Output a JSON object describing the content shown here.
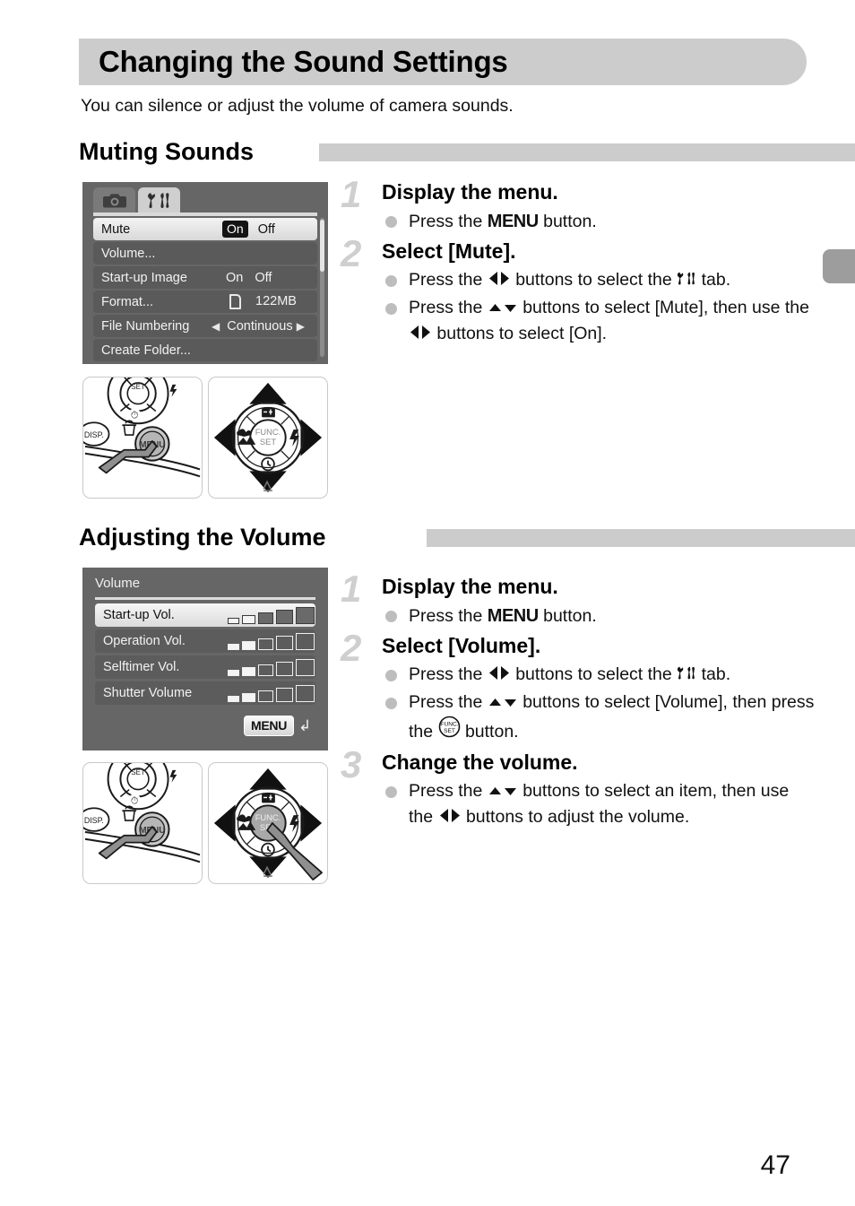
{
  "page": {
    "title": "Changing the Sound Settings",
    "intro": "You can silence or adjust the volume of camera sounds.",
    "page_number": "47"
  },
  "sections": [
    {
      "id": "muting",
      "heading": "Muting Sounds"
    },
    {
      "id": "volume",
      "heading": "Adjusting the Volume"
    }
  ],
  "menu_screen": {
    "tabs": [
      {
        "name": "camera-tab",
        "icon": "camera-icon",
        "active": false
      },
      {
        "name": "settings-tab",
        "icon": "wrench-tools-icon",
        "active": true
      }
    ],
    "rows": [
      {
        "label": "Mute",
        "selected": true,
        "value_on": "On",
        "value_off": "Off"
      },
      {
        "label": "Volume...",
        "selected": false,
        "value": ""
      },
      {
        "label": "Start-up Image",
        "selected": false,
        "value_on": "On",
        "value_off": "Off"
      },
      {
        "label": "Format...",
        "selected": false,
        "value": "122MB",
        "icon": "memory-card-icon"
      },
      {
        "label": "File Numbering",
        "selected": false,
        "value": "Continuous",
        "arrows": true
      },
      {
        "label": "Create Folder...",
        "selected": false,
        "value": ""
      }
    ]
  },
  "volume_screen": {
    "title": "Volume",
    "rows": [
      {
        "label": "Start-up Vol.",
        "selected": true,
        "level": 2,
        "max": 5
      },
      {
        "label": "Operation Vol.",
        "selected": false,
        "level": 2,
        "max": 5
      },
      {
        "label": "Selftimer Vol.",
        "selected": false,
        "level": 2,
        "max": 5
      },
      {
        "label": "Shutter Volume",
        "selected": false,
        "level": 2,
        "max": 5
      }
    ],
    "return_button": "MENU",
    "return_icon": "return-arrow-icon"
  },
  "photos": {
    "menu_button_photo": "camera-back-menu-button-photo",
    "dpad_photo": "camera-dpad-photo",
    "dpad_func_set_photo": "camera-dpad-func-set-photo",
    "labels": {
      "disp": "DISP.",
      "menu": "MENU",
      "set": "SET",
      "func_set_line1": "FUNC.",
      "func_set_line2": "SET"
    }
  },
  "steps_muting": [
    {
      "number": "1",
      "heading": "Display the menu.",
      "bullets": [
        {
          "parts": [
            {
              "t": "text",
              "v": "Press the "
            },
            {
              "t": "menu",
              "v": "MENU"
            },
            {
              "t": "text",
              "v": " button."
            }
          ]
        }
      ]
    },
    {
      "number": "2",
      "heading": "Select [Mute].",
      "bullets": [
        {
          "parts": [
            {
              "t": "text",
              "v": "Press the "
            },
            {
              "t": "icon",
              "v": "left-right-arrows-icon"
            },
            {
              "t": "text",
              "v": " buttons to select the "
            },
            {
              "t": "icon",
              "v": "wrench-tools-icon"
            },
            {
              "t": "text",
              "v": " tab."
            }
          ]
        },
        {
          "parts": [
            {
              "t": "text",
              "v": "Press the "
            },
            {
              "t": "icon",
              "v": "up-down-arrows-icon"
            },
            {
              "t": "text",
              "v": " buttons to select [Mute], then use the "
            },
            {
              "t": "icon",
              "v": "left-right-arrows-icon"
            },
            {
              "t": "text",
              "v": " buttons to select [On]."
            }
          ]
        }
      ]
    }
  ],
  "steps_volume": [
    {
      "number": "1",
      "heading": "Display the menu.",
      "bullets": [
        {
          "parts": [
            {
              "t": "text",
              "v": "Press the "
            },
            {
              "t": "menu",
              "v": "MENU"
            },
            {
              "t": "text",
              "v": " button."
            }
          ]
        }
      ]
    },
    {
      "number": "2",
      "heading": "Select [Volume].",
      "bullets": [
        {
          "parts": [
            {
              "t": "text",
              "v": "Press the "
            },
            {
              "t": "icon",
              "v": "left-right-arrows-icon"
            },
            {
              "t": "text",
              "v": " buttons to select the "
            },
            {
              "t": "icon",
              "v": "wrench-tools-icon"
            },
            {
              "t": "text",
              "v": " tab."
            }
          ]
        },
        {
          "parts": [
            {
              "t": "text",
              "v": "Press the "
            },
            {
              "t": "icon",
              "v": "up-down-arrows-icon"
            },
            {
              "t": "text",
              "v": " buttons to select [Volume], then press the "
            },
            {
              "t": "icon",
              "v": "func-set-icon"
            },
            {
              "t": "text",
              "v": " button."
            }
          ]
        }
      ]
    },
    {
      "number": "3",
      "heading": "Change the volume.",
      "bullets": [
        {
          "parts": [
            {
              "t": "text",
              "v": "Press the "
            },
            {
              "t": "icon",
              "v": "up-down-arrows-icon"
            },
            {
              "t": "text",
              "v": " buttons to select an item, then use the "
            },
            {
              "t": "icon",
              "v": "left-right-arrows-icon"
            },
            {
              "t": "text",
              "v": " buttons to adjust the volume."
            }
          ]
        }
      ]
    }
  ],
  "colors": {
    "heading_bar": "#cccccc",
    "lcd_background": "#666666",
    "lcd_row": "#5a5a5a",
    "lcd_row_selected": "#eeeeee",
    "step_number": "#cfcfcf",
    "bullet": "#bdbdbd",
    "edge_tab": "#9d9d9d"
  }
}
